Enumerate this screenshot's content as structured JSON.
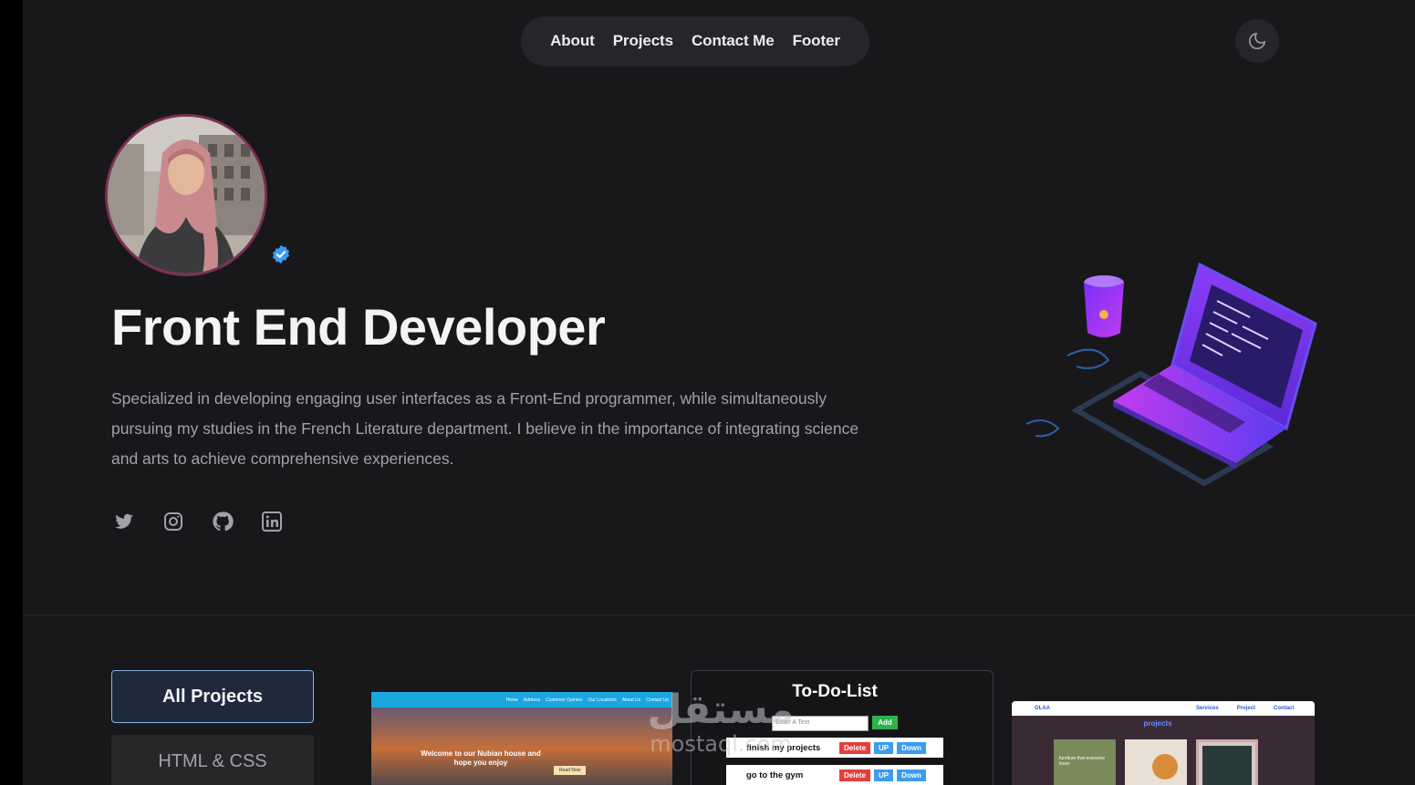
{
  "nav": {
    "items": [
      {
        "label": "About"
      },
      {
        "label": "Projects"
      },
      {
        "label": "Contact Me"
      },
      {
        "label": "Footer"
      }
    ]
  },
  "theme_toggle": {
    "icon": "moon-icon"
  },
  "hero": {
    "avatar_icon": "profile-photo",
    "verified_icon": "verified-badge-icon",
    "title": "Front End Developer",
    "description": "Specialized in developing engaging user interfaces as a Front-End programmer, while simultaneously pursuing my studies in the French Literature department. I believe in the importance of integrating science and arts to achieve comprehensive experiences.",
    "social": [
      {
        "icon": "twitter-icon"
      },
      {
        "icon": "instagram-icon"
      },
      {
        "icon": "github-icon"
      },
      {
        "icon": "linkedin-icon"
      }
    ]
  },
  "filters": [
    {
      "label": "All Projects",
      "active": true
    },
    {
      "label": "HTML & CSS",
      "active": false
    }
  ],
  "projects": {
    "card1": {
      "nav": [
        "Home",
        "Address",
        "Customer Opinion",
        "Our Locations",
        "About Us",
        "Contact Us"
      ],
      "headline": "Welcome to our Nubian house and hope you enjoy",
      "cta": "Read Now"
    },
    "card2": {
      "title": "To-Do-List",
      "placeholder": "Enter A Text",
      "add": "Add",
      "tasks": [
        {
          "text": "finish my projects"
        },
        {
          "text": "go to the gym"
        }
      ],
      "btn_delete": "Delete",
      "btn_up": "UP",
      "btn_down": "Down"
    },
    "card3": {
      "brand": "OLAA",
      "nav": [
        "Services",
        "Project",
        "Contact"
      ],
      "heading": "projects",
      "tile_text": "furniture that everyone loves"
    }
  },
  "watermark": {
    "arabic": "مستقل",
    "latin": "mostaql.com"
  },
  "colors": {
    "background": "#18181b",
    "nav_bg": "#26262a",
    "accent_border": "#8ab4e0",
    "verified": "#3b9cf0"
  }
}
